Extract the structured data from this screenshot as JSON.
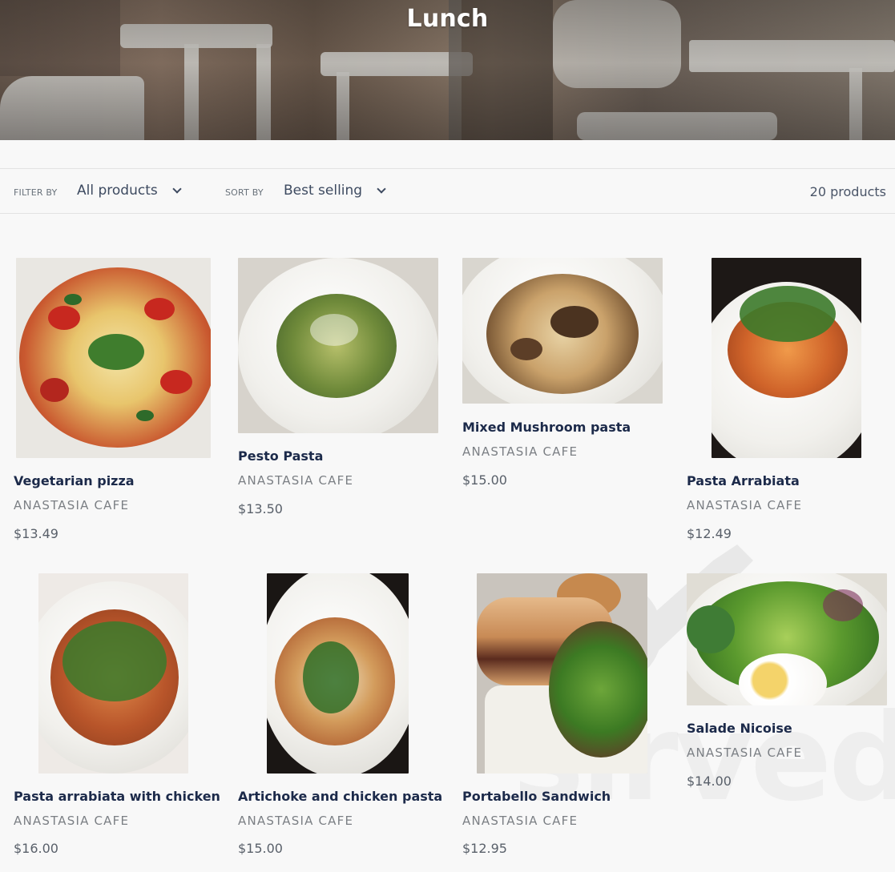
{
  "collection": {
    "title": "Lunch"
  },
  "filter": {
    "label": "FILTER BY",
    "value": "All products"
  },
  "sort": {
    "label": "SORT BY",
    "value": "Best selling"
  },
  "product_count": "20 products",
  "products": [
    {
      "name": "Vegetarian pizza",
      "vendor": "ANASTASIA CAFE",
      "price": "$13.49"
    },
    {
      "name": "Pesto Pasta",
      "vendor": "ANASTASIA CAFE",
      "price": "$13.50"
    },
    {
      "name": "Mixed Mushroom pasta",
      "vendor": "ANASTASIA CAFE",
      "price": "$15.00"
    },
    {
      "name": "Pasta Arrabiata",
      "vendor": "ANASTASIA CAFE",
      "price": "$12.49"
    },
    {
      "name": "Pasta arrabiata with chicken",
      "vendor": "ANASTASIA CAFE",
      "price": "$16.00"
    },
    {
      "name": "Artichoke and chicken pasta",
      "vendor": "ANASTASIA CAFE",
      "price": "$15.00"
    },
    {
      "name": "Portabello Sandwich",
      "vendor": "ANASTASIA CAFE",
      "price": "$12.95"
    },
    {
      "name": "Salade Nicoise",
      "vendor": "ANASTASIA CAFE",
      "price": "$14.00"
    }
  ],
  "watermark": "sirved",
  "colors": {
    "product_title": "#1c2a4a",
    "vendor": "#7b7f84",
    "price": "#59606a",
    "background": "#f8f8f8"
  }
}
